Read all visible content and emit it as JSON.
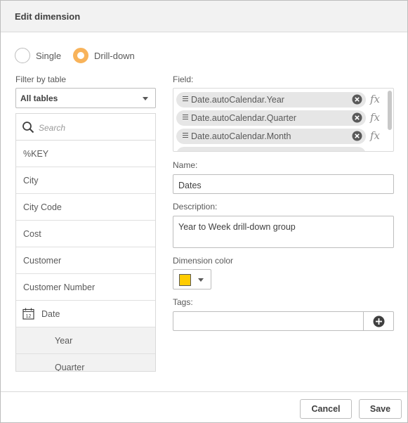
{
  "dialog": {
    "title": "Edit dimension"
  },
  "type": {
    "single_label": "Single",
    "drilldown_label": "Drill-down",
    "selected": "Drill-down"
  },
  "filter": {
    "label": "Filter by table",
    "selected": "All tables"
  },
  "search": {
    "placeholder": "Search"
  },
  "field_list": [
    {
      "label": "%KEY"
    },
    {
      "label": "City"
    },
    {
      "label": "City Code"
    },
    {
      "label": "Cost"
    },
    {
      "label": "Customer"
    },
    {
      "label": "Customer Number"
    },
    {
      "label": "Date",
      "icon": "calendar-icon"
    },
    {
      "label": "Year"
    },
    {
      "label": "Quarter"
    }
  ],
  "fields": {
    "label": "Field:",
    "items": [
      {
        "label": "Date.autoCalendar.Year"
      },
      {
        "label": "Date.autoCalendar.Quarter"
      },
      {
        "label": "Date.autoCalendar.Month"
      }
    ],
    "fx_label": "fx"
  },
  "name": {
    "label": "Name:",
    "value": "Dates"
  },
  "description": {
    "label": "Description:",
    "value": "Year to Week drill-down group"
  },
  "dimension_color": {
    "label": "Dimension color",
    "color": "#ffcc00"
  },
  "tags": {
    "label": "Tags:",
    "value": ""
  },
  "footer": {
    "cancel_label": "Cancel",
    "save_label": "Save"
  },
  "colors": {
    "accent": "#f8b35a",
    "header_bg": "#f2f2f2",
    "chip_bg": "#e6e6e6"
  }
}
